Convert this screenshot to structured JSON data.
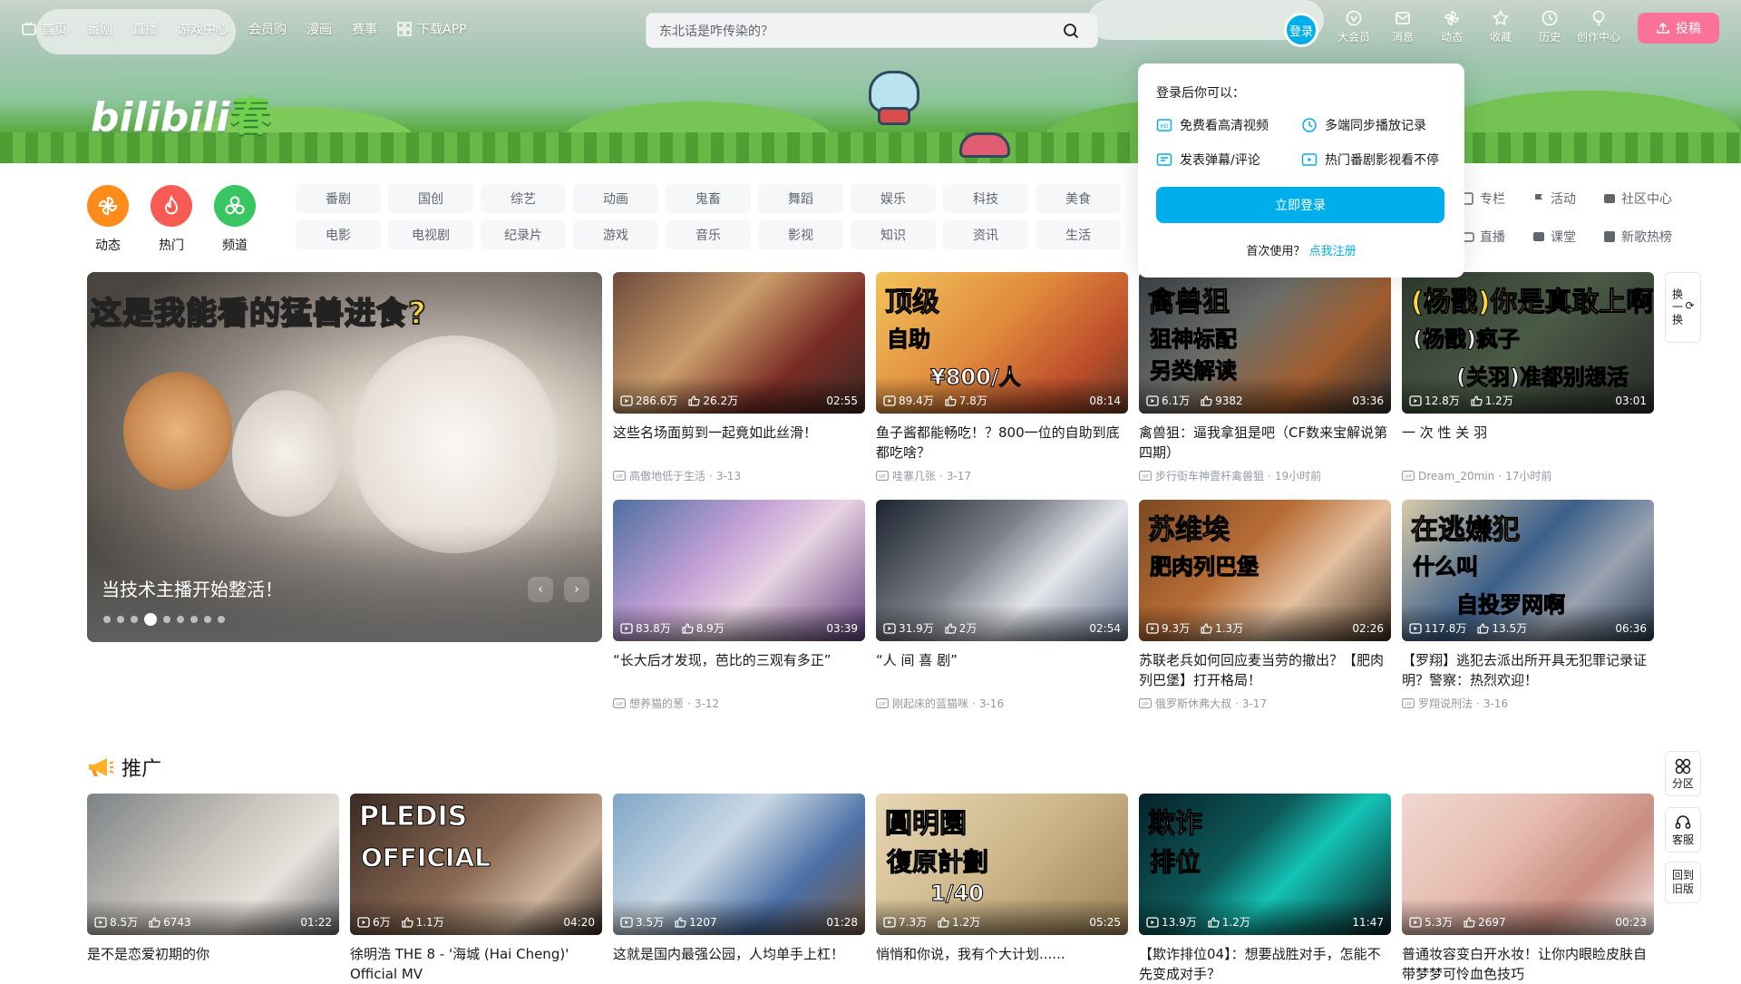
{
  "nav": {
    "home": "首页",
    "bangumi": "番剧",
    "live": "直播",
    "game": "游戏中心",
    "vip_shop": "会员购",
    "manga": "漫画",
    "match": "赛事",
    "app": "下载APP"
  },
  "search": {
    "placeholder": "东北话是咋传染的？"
  },
  "header_right": {
    "login": "登录",
    "vip": "大会员",
    "msg": "消息",
    "dynamic": "动态",
    "fav": "收藏",
    "history": "历史",
    "creator": "创作中心",
    "upload": "投稿"
  },
  "logo": {
    "text": "bilibili",
    "season": "春"
  },
  "channel_icons": [
    {
      "label": "动态",
      "color": "#ff8c1a"
    },
    {
      "label": "热门",
      "color": "#f85a54"
    },
    {
      "label": "频道",
      "color": "#39c562"
    }
  ],
  "channels_row1": [
    "番剧",
    "国创",
    "综艺",
    "动画",
    "鬼畜",
    "舞蹈",
    "娱乐",
    "科技",
    "美食"
  ],
  "channels_row2": [
    "电影",
    "电视剧",
    "纪录片",
    "游戏",
    "音乐",
    "影视",
    "知识",
    "资讯",
    "生活"
  ],
  "channels_right": [
    "专栏",
    "活动",
    "社区中心",
    "直播",
    "课堂",
    "新歌热榜"
  ],
  "login_popup": {
    "title": "登录后你可以：",
    "features": [
      "免费看高清视频",
      "多端同步播放记录",
      "发表弹幕/评论",
      "热门番剧影视看不停"
    ],
    "button": "立即登录",
    "first_use": "首次使用？",
    "register": "点我注册"
  },
  "carousel": {
    "caption_a": "这是我能看的",
    "caption_b": "猛兽进食?",
    "title": "当技术主播开始整活！",
    "active_dot": 4,
    "dot_count": 9
  },
  "videos": [
    {
      "views": "286.6万",
      "likes": "26.2万",
      "duration": "02:55",
      "title": "这些名场面剪到一起竟如此丝滑！",
      "uploader": "高傲地低于生活",
      "date": "3-13"
    },
    {
      "views": "89.4万",
      "likes": "7.8万",
      "duration": "08:14",
      "title": "鱼子酱都能畅吃！？800一位的自助到底都吃啥？",
      "uploader": "哇寨几张",
      "date": "3-17",
      "thumb_text_a": "顶级",
      "thumb_text_b": "自助",
      "thumb_text_c": "¥800/人"
    },
    {
      "views": "6.1万",
      "likes": "9382",
      "duration": "03:36",
      "title": "禽兽狙：逼我拿狙是吧（CF数来宝解说第四期）",
      "uploader": "步行街车神壹杆禽兽狙",
      "date": "19小时前",
      "thumb_text_a": "禽兽狙",
      "thumb_text_b": "狙神标配\n另类解读"
    },
    {
      "views": "12.8万",
      "likes": "1.2万",
      "duration": "03:01",
      "title": "一 次 性 关 羽",
      "uploader": "Dream_20min",
      "date": "17小时前",
      "thumb_text_a": "(杨戬)你是真敢上啊",
      "thumb_text_b": "(杨戬)疯子",
      "thumb_text_c": "(关羽)准都别想活"
    },
    {
      "views": "83.8万",
      "likes": "8.9万",
      "duration": "03:39",
      "title": "“长大后才发现，芭比的三观有多正”",
      "uploader": "想养猫的葱",
      "date": "3-12"
    },
    {
      "views": "31.9万",
      "likes": "2万",
      "duration": "02:54",
      "title": "“人 间 喜 剧”",
      "uploader": "刚起床的蓝猫咪",
      "date": "3-16"
    },
    {
      "views": "9.3万",
      "likes": "1.3万",
      "duration": "02:26",
      "title": "苏联老兵如何回应麦当劳的撤出？【肥肉列巴堡】打开格局！",
      "uploader": "俄罗斯休弗大叔",
      "date": "3-17",
      "thumb_text_a": "苏维埃",
      "thumb_text_b": "肥肉列巴堡"
    },
    {
      "views": "117.8万",
      "likes": "13.5万",
      "duration": "06:36",
      "title": "【罗翔】逃犯去派出所开具无犯罪记录证明？警察：热烈欢迎！",
      "uploader": "罗翔说刑法",
      "date": "3-16",
      "thumb_text_a": "在逃嫌犯",
      "thumb_text_b": "什么叫",
      "thumb_text_c": "自投罗网啊"
    }
  ],
  "side_refresh": "换一换",
  "promo": {
    "title": "推广",
    "videos": [
      {
        "views": "8.5万",
        "likes": "6743",
        "duration": "01:22",
        "title": "是不是恋爱初期的你"
      },
      {
        "views": "6万",
        "likes": "1.1万",
        "duration": "04:20",
        "title": "徐明浩 THE 8 - '海城 (Hai Cheng)' Official MV",
        "thumb_text_a": "PLEDIS",
        "thumb_text_b": "OFFICIAL"
      },
      {
        "views": "3.5万",
        "likes": "1207",
        "duration": "01:28",
        "title": "这就是国内最强公园，人均单手上杠！"
      },
      {
        "views": "7.3万",
        "likes": "1.2万",
        "duration": "05:25",
        "title": "悄悄和你说，我有个大计划......",
        "thumb_text_a": "圓明園",
        "thumb_text_b": "復原計劃",
        "thumb_text_c": "1/40"
      },
      {
        "views": "13.9万",
        "likes": "1.2万",
        "duration": "11:47",
        "title": "【欺诈排位04】：想要战胜对手，怎能不先变成对手？",
        "thumb_text_a": "欺诈",
        "thumb_text_b": "排位"
      },
      {
        "views": "5.3万",
        "likes": "2697",
        "duration": "00:23",
        "title": "普通妆容变白开水妆！让你内眼睑皮肤自带梦梦可怜血色技巧"
      }
    ]
  },
  "side_tools": {
    "partition": "分区",
    "service": "客服",
    "old_line1": "回到",
    "old_line2": "旧版"
  }
}
